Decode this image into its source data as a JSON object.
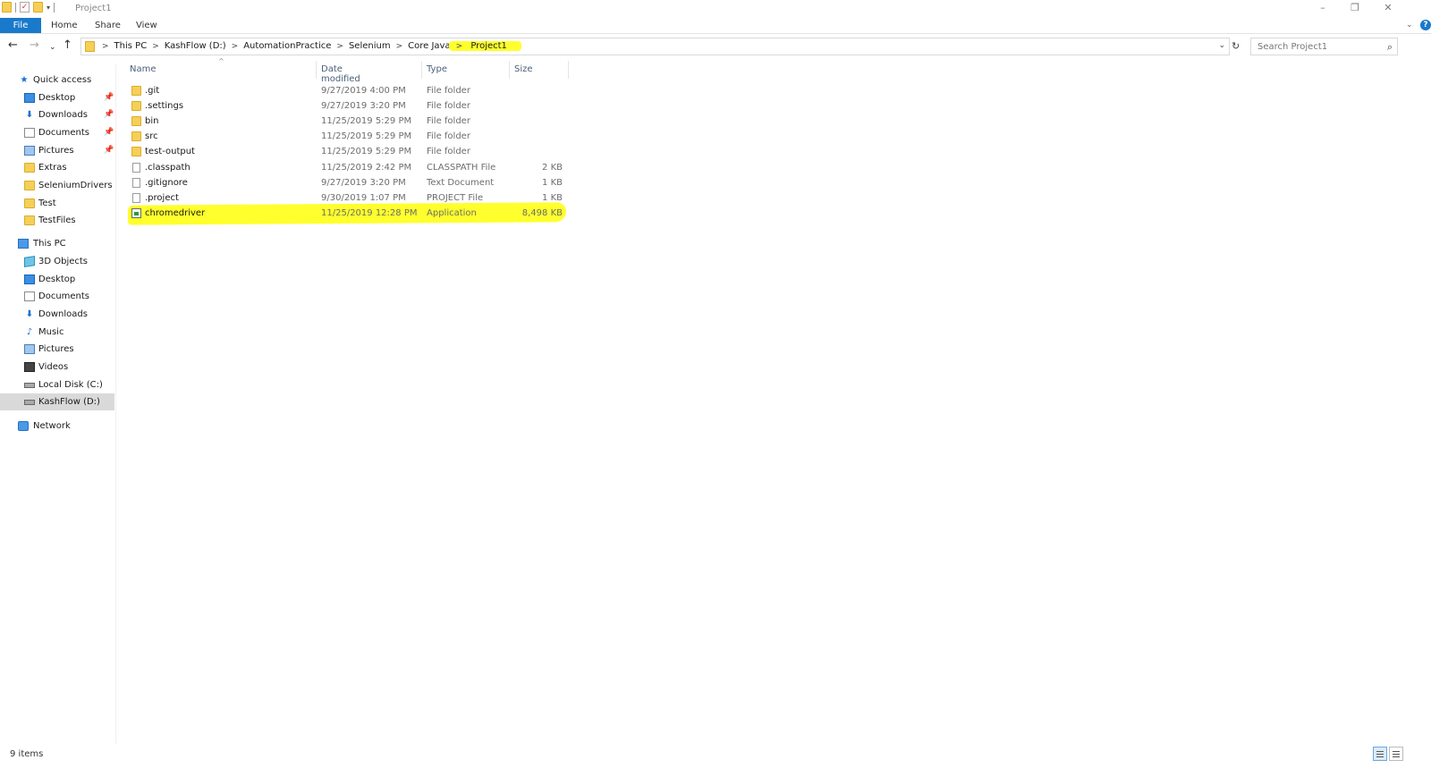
{
  "window": {
    "title": "Project1",
    "controls": {
      "minimize": "–",
      "maximize": "❐",
      "close": "✕"
    },
    "ribbon_toggle": "⌄",
    "help": "?"
  },
  "ribbon": {
    "file_tab": "File",
    "tabs": [
      "Home",
      "Share",
      "View"
    ]
  },
  "nav": {
    "back": "←",
    "forward": "→",
    "recent": "⌄",
    "up": "↑",
    "breadcrumb": [
      "This PC",
      "KashFlow (D:)",
      "AutomationPractice",
      "Selenium",
      "Core Java",
      "Project1"
    ],
    "crumb_separator": ">",
    "dropdown": "⌄",
    "refresh": "↻",
    "search_placeholder": "Search Project1",
    "search_icon": "⌕"
  },
  "sidebar": {
    "quick_access": "Quick access",
    "quick_items": [
      {
        "label": "Desktop",
        "pinned": true,
        "icon": "desktop-icon"
      },
      {
        "label": "Downloads",
        "pinned": true,
        "icon": "downloads-icon"
      },
      {
        "label": "Documents",
        "pinned": true,
        "icon": "documents-icon"
      },
      {
        "label": "Pictures",
        "pinned": true,
        "icon": "pictures-icon"
      },
      {
        "label": "Extras",
        "pinned": false,
        "icon": "folder-icon"
      },
      {
        "label": "SeleniumDrivers",
        "pinned": false,
        "icon": "folder-icon"
      },
      {
        "label": "Test",
        "pinned": false,
        "icon": "folder-icon"
      },
      {
        "label": "TestFiles",
        "pinned": false,
        "icon": "folder-icon"
      }
    ],
    "pin_glyph": "📌",
    "this_pc": "This PC",
    "pc_items": [
      {
        "label": "3D Objects",
        "icon": "3d-objects-icon"
      },
      {
        "label": "Desktop",
        "icon": "desktop-icon"
      },
      {
        "label": "Documents",
        "icon": "documents-icon"
      },
      {
        "label": "Downloads",
        "icon": "downloads-icon"
      },
      {
        "label": "Music",
        "icon": "music-icon"
      },
      {
        "label": "Pictures",
        "icon": "pictures-icon"
      },
      {
        "label": "Videos",
        "icon": "videos-icon"
      },
      {
        "label": "Local Disk (C:)",
        "icon": "local-disk-icon"
      },
      {
        "label": "KashFlow (D:)",
        "icon": "drive-icon",
        "selected": true
      }
    ],
    "network": "Network"
  },
  "columns": {
    "name": "Name",
    "date": "Date modified",
    "type": "Type",
    "size": "Size",
    "sort_indicator": "^"
  },
  "files": [
    {
      "name": ".git",
      "date": "9/27/2019 4:00 PM",
      "type": "File folder",
      "size": "",
      "kind": "folder"
    },
    {
      "name": ".settings",
      "date": "9/27/2019 3:20 PM",
      "type": "File folder",
      "size": "",
      "kind": "folder"
    },
    {
      "name": "bin",
      "date": "11/25/2019 5:29 PM",
      "type": "File folder",
      "size": "",
      "kind": "folder"
    },
    {
      "name": "src",
      "date": "11/25/2019 5:29 PM",
      "type": "File folder",
      "size": "",
      "kind": "folder"
    },
    {
      "name": "test-output",
      "date": "11/25/2019 5:29 PM",
      "type": "File folder",
      "size": "",
      "kind": "folder"
    },
    {
      "name": ".classpath",
      "date": "11/25/2019 2:42 PM",
      "type": "CLASSPATH File",
      "size": "2 KB",
      "kind": "file"
    },
    {
      "name": ".gitignore",
      "date": "9/27/2019 3:20 PM",
      "type": "Text Document",
      "size": "1 KB",
      "kind": "file"
    },
    {
      "name": ".project",
      "date": "9/30/2019 1:07 PM",
      "type": "PROJECT File",
      "size": "1 KB",
      "kind": "file"
    },
    {
      "name": "chromedriver",
      "date": "11/25/2019 12:28 PM",
      "type": "Application",
      "size": "8,498 KB",
      "kind": "app",
      "highlighted": true
    }
  ],
  "status": {
    "item_count": "9 items"
  },
  "colors": {
    "accent": "#1979ca",
    "highlight": "#ffff2d",
    "folder": "#f6cf57",
    "selected_nav": "#d9d9d9"
  }
}
